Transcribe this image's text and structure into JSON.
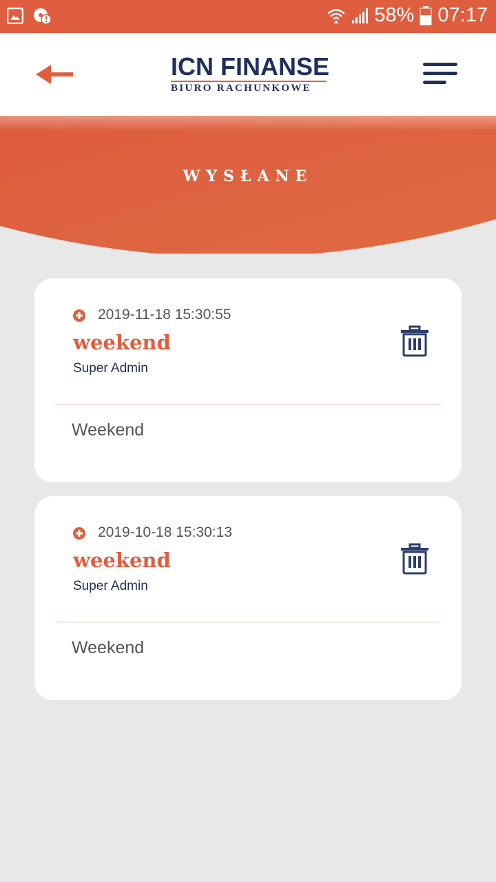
{
  "status_bar": {
    "battery_percent": "58%",
    "time": "07:17",
    "icons": [
      "gallery-icon",
      "app-alert-icon",
      "wifi-icon",
      "signal-icon",
      "battery-icon"
    ]
  },
  "header": {
    "back_icon": "arrow-left-icon",
    "logo_title": "ICN FINANSE",
    "logo_subtitle": "BIURO RACHUNKOWE",
    "menu_icon": "hamburger-menu-icon"
  },
  "banner": {
    "title": "WYSŁANE"
  },
  "messages": [
    {
      "date": "2019-11-18 15:30:55",
      "title": "weekend",
      "author": "Super Admin",
      "body": "Weekend"
    },
    {
      "date": "2019-10-18 15:30:13",
      "title": "weekend",
      "author": "Super Admin",
      "body": "Weekend"
    }
  ],
  "colors": {
    "accent": "#df5e3f",
    "navy": "#1e2f5c",
    "background": "#e8e8e8",
    "card": "#ffffff"
  }
}
